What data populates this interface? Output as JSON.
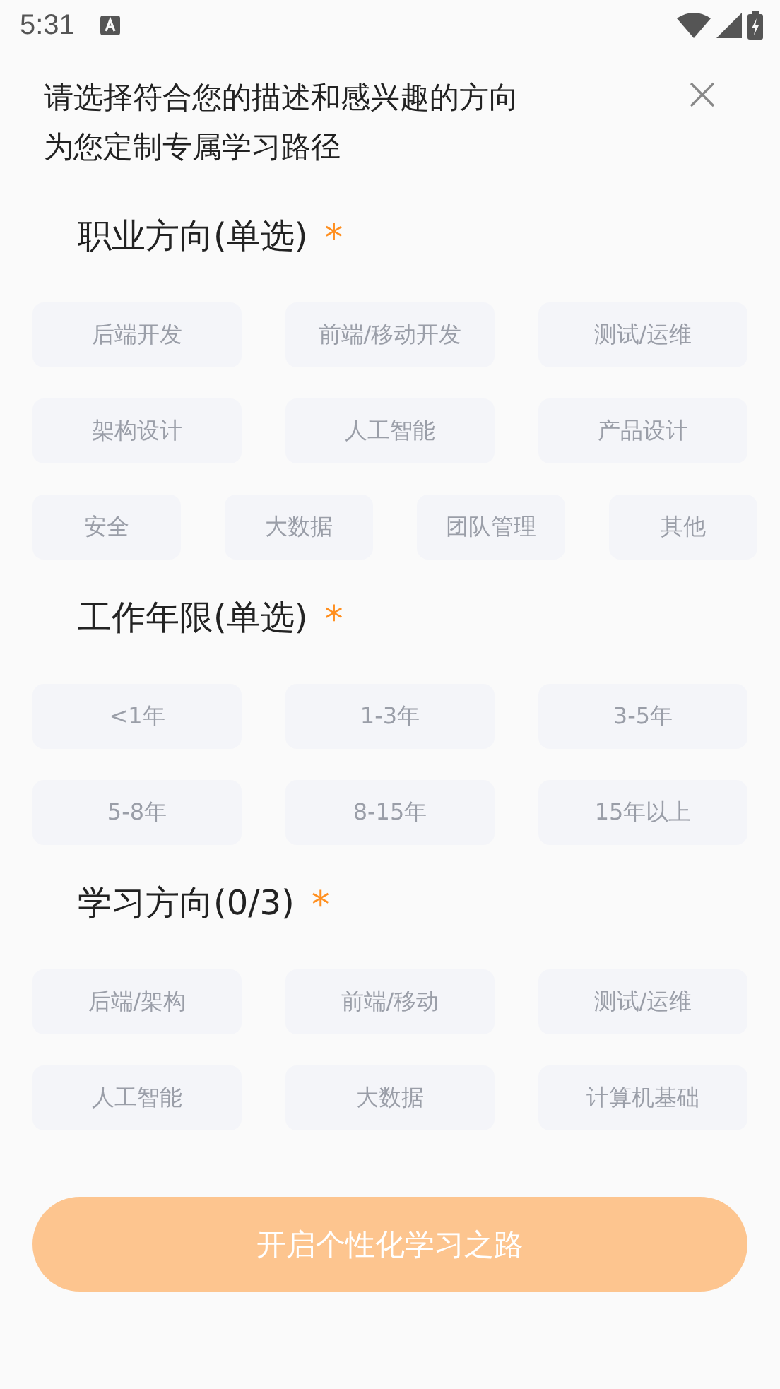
{
  "status_bar": {
    "time": "5:31"
  },
  "header": {
    "lines": [
      "请选择符合您的描述和感兴趣的方向",
      "为您定制专属学习路径"
    ]
  },
  "sections": [
    {
      "title": "职业方向(单选)",
      "mark": "*",
      "options": [
        {
          "label": "后端开发",
          "selected": false
        },
        {
          "label": "前端/移动开发",
          "selected": false
        },
        {
          "label": "测试/运维",
          "selected": false
        },
        {
          "label": "架构设计",
          "selected": false
        },
        {
          "label": "人工智能",
          "selected": false
        },
        {
          "label": "产品设计",
          "selected": false
        }
      ],
      "extra_row": [
        {
          "label": "安全",
          "selected": false
        },
        {
          "label": "大数据",
          "selected": false
        },
        {
          "label": "团队管理",
          "selected": false
        },
        {
          "label": "其他",
          "selected": false
        }
      ]
    },
    {
      "title": "工作年限(单选)",
      "mark": "*",
      "options": [
        {
          "label": "<1年",
          "selected": false
        },
        {
          "label": "1-3年",
          "selected": false
        },
        {
          "label": "3-5年",
          "selected": false
        },
        {
          "label": "5-8年",
          "selected": false
        },
        {
          "label": "8-15年",
          "selected": false
        },
        {
          "label": "15年以上",
          "selected": false
        }
      ]
    },
    {
      "title": "学习方向(0/3)",
      "mark": "*",
      "options": [
        {
          "label": "后端/架构",
          "selected": false
        },
        {
          "label": "前端/移动",
          "selected": false
        },
        {
          "label": "测试/运维",
          "selected": false
        },
        {
          "label": "人工智能",
          "selected": false
        },
        {
          "label": "大数据",
          "selected": false
        },
        {
          "label": "计算机基础",
          "selected": false
        }
      ]
    }
  ],
  "submit": {
    "label": "开启个性化学习之路",
    "disabled": true
  }
}
